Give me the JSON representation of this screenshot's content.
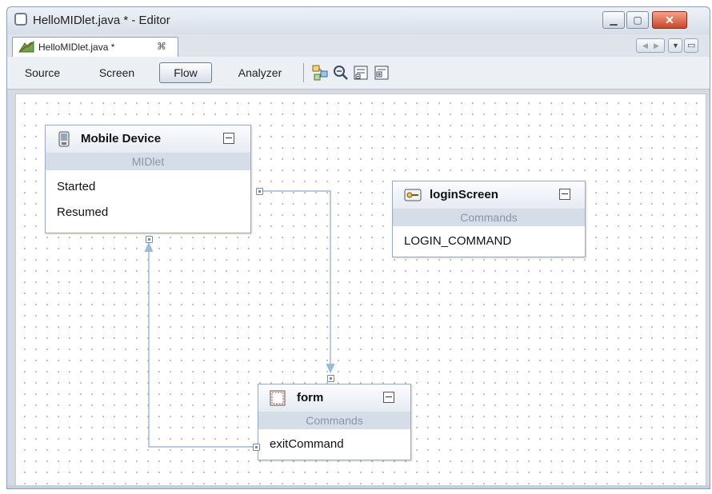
{
  "window": {
    "title": "HelloMIDlet.java * - Editor",
    "icon": "document-outline-icon",
    "controls": [
      "minimize-icon",
      "maximize-icon",
      "close-icon"
    ]
  },
  "tab": {
    "label": "HelloMIDlet.java *",
    "icon": "midlet-file-icon",
    "close_glyph": "⌘"
  },
  "toolbar": {
    "views": [
      {
        "label": "Source",
        "active": false
      },
      {
        "label": "Screen",
        "active": false
      },
      {
        "label": "Flow",
        "active": true
      },
      {
        "label": "Analyzer",
        "active": false
      }
    ],
    "icons": [
      "layout-icon",
      "zoom-out-icon",
      "collapse-all-icon",
      "expand-all-icon"
    ]
  },
  "nodes": {
    "mobile_device": {
      "title": "Mobile Device",
      "subtitle": "MIDlet",
      "items": [
        "Started",
        "Resumed"
      ],
      "icon": "mobile-phone-icon"
    },
    "login_screen": {
      "title": "loginScreen",
      "subtitle": "Commands",
      "items": [
        "LOGIN_COMMAND"
      ],
      "icon": "login-key-icon"
    },
    "form": {
      "title": "form",
      "subtitle": "Commands",
      "items": [
        "exitCommand"
      ],
      "icon": "form-icon"
    }
  },
  "colors": {
    "accent": "#6e7c92",
    "node_border": "#9aa9c0",
    "wire": "#9bbad6"
  }
}
